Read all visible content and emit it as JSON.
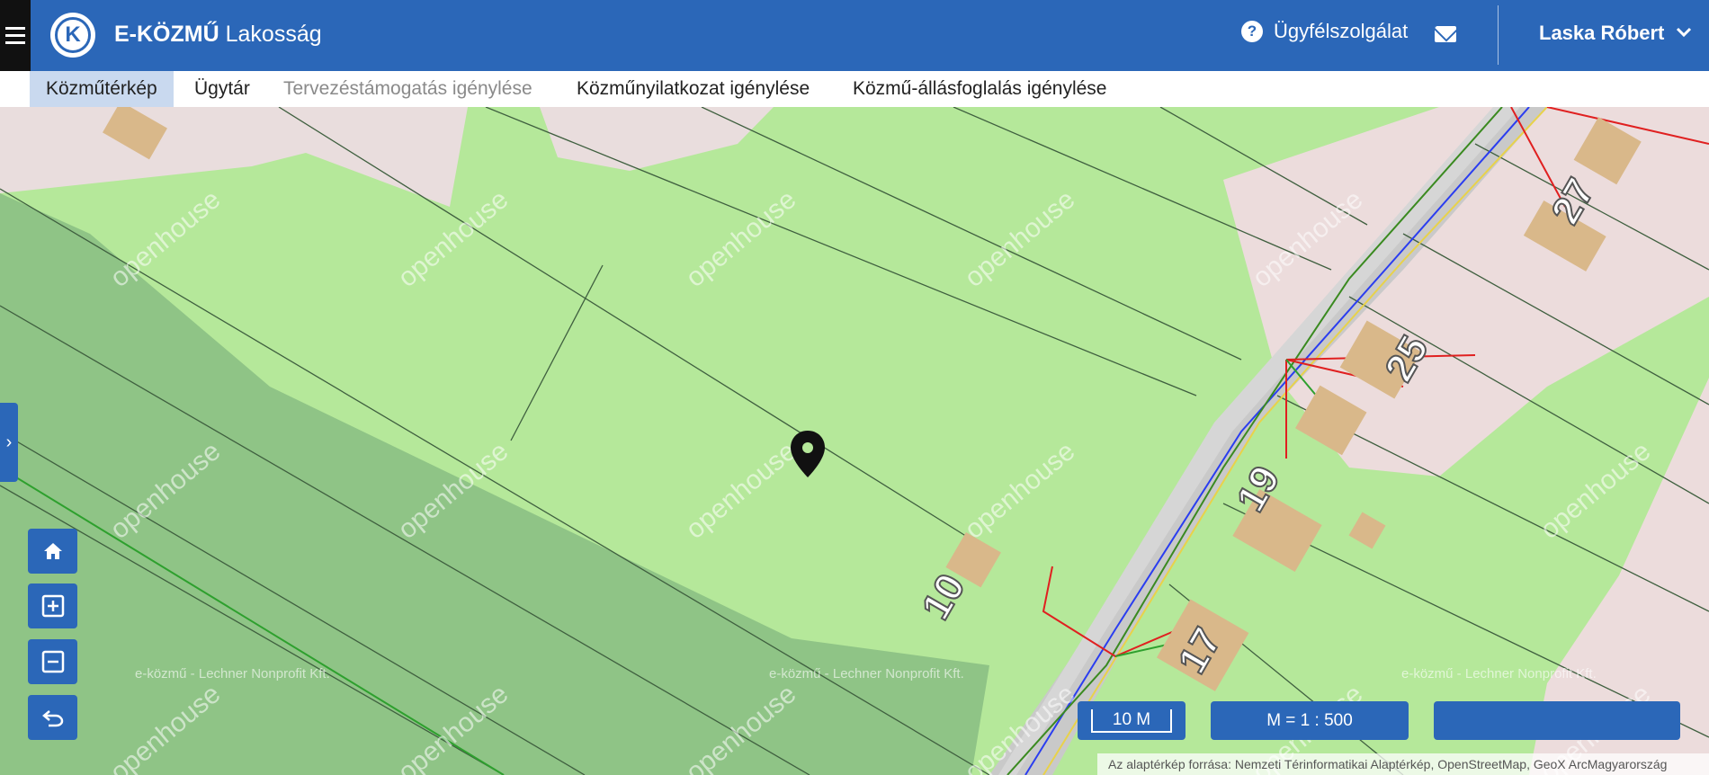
{
  "header": {
    "brand": "E-KÖZMŰ",
    "subtitle": "Lakosság",
    "logo_letter": "K",
    "help_label": "Ügyfélszolgálat",
    "user_name": "Laska Róbert"
  },
  "nav": {
    "tabs": [
      {
        "label": "Közműtérkép",
        "state": "active"
      },
      {
        "label": "Ügytár",
        "state": "normal"
      },
      {
        "label": "Tervezéstámogatás igénylése",
        "state": "disabled"
      },
      {
        "label": "Közműnyilatkozat igénylése",
        "state": "normal"
      },
      {
        "label": "Közmű-állásfoglalás igénylése",
        "state": "normal"
      }
    ]
  },
  "map": {
    "house_numbers": [
      "27",
      "25",
      "19",
      "10",
      "17"
    ],
    "watermark": "openhouse",
    "copyright_left": "e-közmű - Lechner Nonprofit Kft.",
    "copyright_mid": "e-közmű - Lechner Nonprofit Kft.",
    "copyright_right": "e-közmű - Lechner Nonprofit Kft.",
    "scale_bar": "10 M",
    "scale_ratio": "M = 1 : 500",
    "attribution": "Az alaptérkép forrása: Nemzeti Térinformatikai Alaptérkép, OpenStreetMap, GeoX ArcMagyarország",
    "controls": [
      "home-icon",
      "zoom-in-icon",
      "zoom-out-icon",
      "undo-icon"
    ]
  },
  "colors": {
    "brand_blue": "#2b67b8",
    "parcel_green": "#b5e89a",
    "forest_green": "#8fc486",
    "road_gray": "#c9c9c9"
  }
}
